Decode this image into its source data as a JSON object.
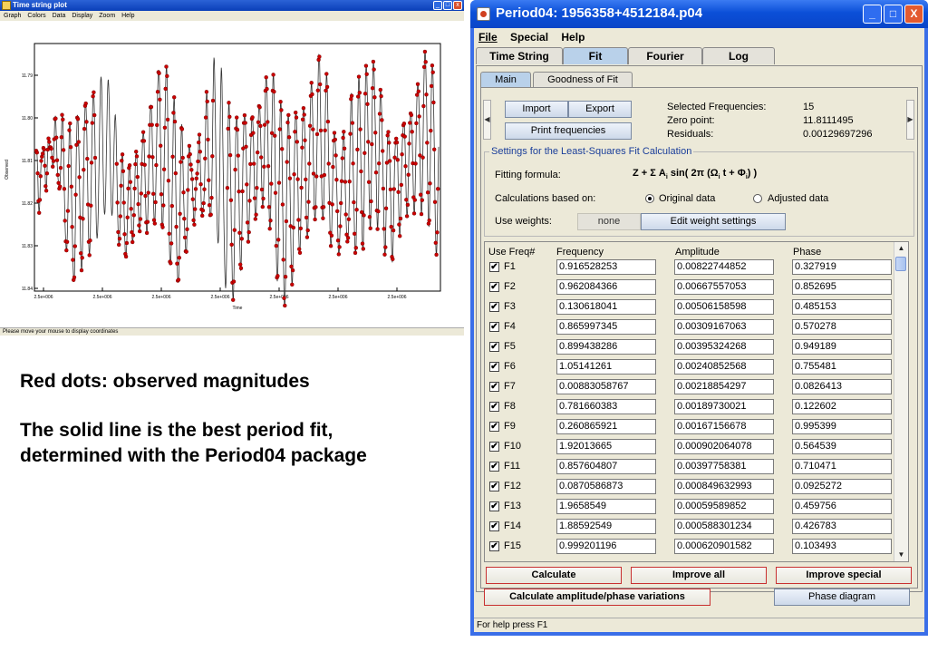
{
  "plot_window": {
    "title": "Time string plot",
    "menu": [
      "Graph",
      "Colors",
      "Data",
      "Display",
      "Zoom",
      "Help"
    ],
    "status": "Please move your mouse to display coordinates",
    "ylabel": "Observed",
    "xlabel": "Time",
    "yticks": [
      "11.79",
      "11.80",
      "11.81",
      "11.82",
      "11.83",
      "11.84"
    ],
    "xticks": [
      "2.5e+006",
      "2.5e+006",
      "2.5e+006",
      "2.5e+006",
      "2.5e+006",
      "2.5e+006",
      "2.5e+006"
    ],
    "colors": {
      "points": "#cc0000",
      "fit_line": "#333333"
    }
  },
  "caption": {
    "line1": "Red dots: observed magnitudes",
    "line2": "The solid line is the best period fit,",
    "line3": "determined with the Period04 package"
  },
  "period04": {
    "title": "Period04: 1956358+4512184.p04",
    "window_buttons": {
      "minimize": "_",
      "maximize": "□",
      "close": "X"
    },
    "menu": [
      "File",
      "Special",
      "Help"
    ],
    "tabs": [
      "Time String",
      "Fit",
      "Fourier",
      "Log"
    ],
    "active_tab": "Fit",
    "subtabs": [
      "Main",
      "Goodness of Fit"
    ],
    "buttons": {
      "import": "Import",
      "export": "Export",
      "print": "Print frequencies",
      "calculate": "Calculate",
      "improve_all": "Improve all",
      "improve_special": "Improve special",
      "calc_amp_phase": "Calculate amplitude/phase variations",
      "phase_diagram": "Phase diagram",
      "edit_weights": "Edit weight settings"
    },
    "summary": {
      "sel_freq_label": "Selected Frequencies:",
      "sel_freq_value": "15",
      "zero_label": "Zero point:",
      "zero_value": "11.8111495",
      "resid_label": "Residuals:",
      "resid_value": "0.00129697296"
    },
    "settings": {
      "legend": "Settings for the Least-Squares Fit Calculation",
      "formula_label": "Fitting formula:",
      "calc_label": "Calculations based on:",
      "original": "Original data",
      "adjusted": "Adjusted data",
      "selected": "original",
      "weights_label": "Use weights:",
      "weights_value": "none"
    },
    "table": {
      "headers": [
        "Use Freq#",
        "Frequency",
        "Amplitude",
        "Phase"
      ],
      "rows": [
        {
          "id": "F1",
          "freq": "0.916528253",
          "amp": "0.00822744852",
          "phase": "0.327919"
        },
        {
          "id": "F2",
          "freq": "0.962084366",
          "amp": "0.00667557053",
          "phase": "0.852695"
        },
        {
          "id": "F3",
          "freq": "0.130618041",
          "amp": "0.00506158598",
          "phase": "0.485153"
        },
        {
          "id": "F4",
          "freq": "0.865997345",
          "amp": "0.00309167063",
          "phase": "0.570278"
        },
        {
          "id": "F5",
          "freq": "0.899438286",
          "amp": "0.00395324268",
          "phase": "0.949189"
        },
        {
          "id": "F6",
          "freq": "1.05141261",
          "amp": "0.00240852568",
          "phase": "0.755481"
        },
        {
          "id": "F7",
          "freq": "0.00883058767",
          "amp": "0.00218854297",
          "phase": "0.0826413"
        },
        {
          "id": "F8",
          "freq": "0.781660383",
          "amp": "0.00189730021",
          "phase": "0.122602"
        },
        {
          "id": "F9",
          "freq": "0.260865921",
          "amp": "0.00167156678",
          "phase": "0.995399"
        },
        {
          "id": "F10",
          "freq": "1.92013665",
          "amp": "0.000902064078",
          "phase": "0.564539"
        },
        {
          "id": "F11",
          "freq": "0.857604807",
          "amp": "0.00397758381",
          "phase": "0.710471"
        },
        {
          "id": "F12",
          "freq": "0.0870586873",
          "amp": "0.000849632993",
          "phase": "0.0925272"
        },
        {
          "id": "F13",
          "freq": "1.9658549",
          "amp": "0.00059589852",
          "phase": "0.459756"
        },
        {
          "id": "F14",
          "freq": "1.88592549",
          "amp": "0.000588301234",
          "phase": "0.426783"
        },
        {
          "id": "F15",
          "freq": "0.999201196",
          "amp": "0.000620901582",
          "phase": "0.103493"
        }
      ]
    },
    "statusbar": "For help press F1"
  }
}
